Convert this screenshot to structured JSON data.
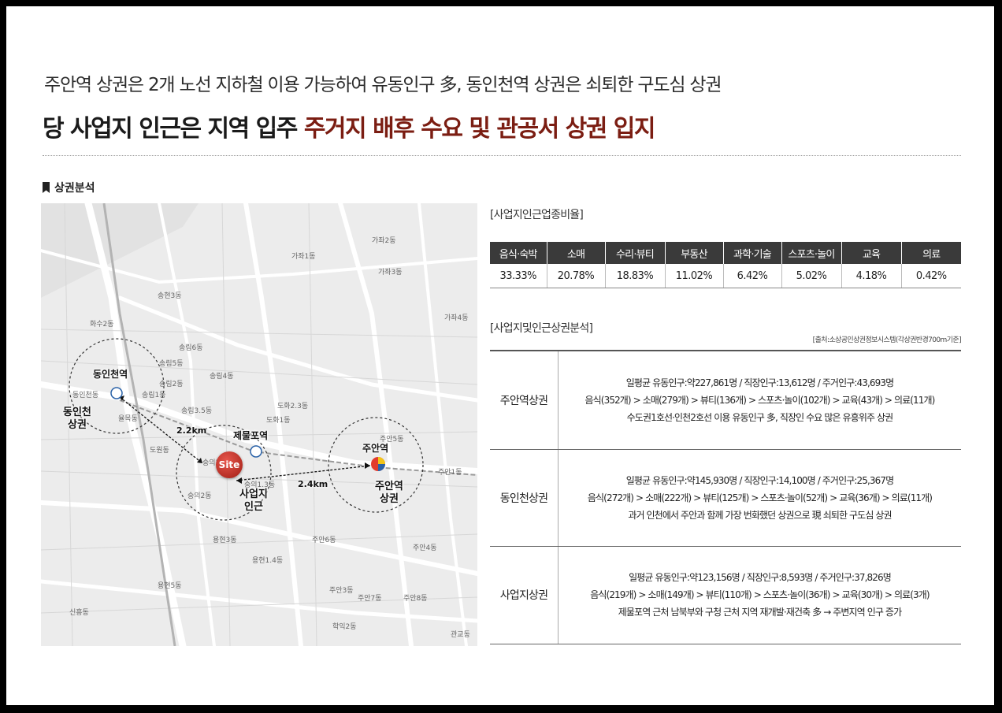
{
  "header": {
    "line1": "주안역 상권은 2개 노선 지하철 이용 가능하여 유동인구 多, 동인천역 상권은 쇠퇴한 구도심 상권",
    "line2_plain": "당 사업지 인근은 지역 입주 ",
    "line2_accent": "주거지 배후 수요 및 관공서 상권 입지",
    "accent_color": "#7b1d12"
  },
  "section_label": "상권분석",
  "map": {
    "districts": [
      "송현3동",
      "화수2동",
      "송림6동",
      "송림5동",
      "송림1동",
      "송림2동",
      "송림4동",
      "송림3.5동",
      "도화1동",
      "도화2.3동",
      "가좌1동",
      "가좌3동",
      "가좌4동",
      "숭의3동",
      "숭의1.3동",
      "숭의2동",
      "주안5동",
      "주안1동",
      "주안4동",
      "주안3동",
      "주안7동",
      "주안8동",
      "주안6동",
      "용현3동",
      "용현1.4동",
      "용현5동",
      "관교동",
      "학익2동",
      "신흥동",
      "율목동",
      "도원동",
      "동인천동",
      "가좌2동"
    ],
    "stations": {
      "dongincheon": "동인천역",
      "jemulpo": "제물포역",
      "juan": "주안역"
    },
    "areas": {
      "dongincheon": "동인천\n상권",
      "site": "사업지\n인근",
      "juan": "주안역\n상권"
    },
    "site_marker": "Site",
    "distance_left": "2.2km",
    "distance_right": "2.4km"
  },
  "ratio": {
    "title": "[사업지인근업종비율]",
    "headers": [
      "음식·숙박",
      "소매",
      "수리·뷰티",
      "부동산",
      "과학·기술",
      "스포츠·놀이",
      "교육",
      "의료"
    ],
    "values": [
      "33.33%",
      "20.78%",
      "18.83%",
      "11.02%",
      "6.42%",
      "5.02%",
      "4.18%",
      "0.42%"
    ]
  },
  "analysis": {
    "title": "[사업지및인근상권분석]",
    "source": "[출처:소상공인상권정보시스템(각상권반경700m기준]",
    "rows": [
      {
        "name": "주안역상권",
        "lines": [
          "일평균 유동인구:약227,861명 / 직장인구:13,612명 / 주거인구:43,693명",
          "음식(352개) > 소매(279개) > 뷰티(136개) > 스포츠·놀이(102개) > 교육(43개) > 의료(11개)",
          "수도권1호선·인천2호선 이용 유동인구 多, 직장인 수요 많은 유흥위주 상권"
        ]
      },
      {
        "name": "동인천상권",
        "lines": [
          "일평균 유동인구:약145,930명 / 직장인구:14,100명 / 주거인구:25,367명",
          "음식(272개) > 소매(222개) > 뷰티(125개) > 스포츠·놀이(52개) > 교육(36개) > 의료(11개)",
          "과거 인천에서 주안과 함께 가장 번화했던 상권으로 現 쇠퇴한 구도심 상권"
        ]
      },
      {
        "name": "사업지상권",
        "lines": [
          "일평균 유동인구:약123,156명 / 직장인구:8,593명 / 주거인구:37,826명",
          "음식(219개) > 소매(149개) > 뷰티(110개) > 스포츠·놀이(36개) > 교육(30개) > 의료(3개)",
          "제물포역 근처 남북부와 구청 근처 지역 재개발·재건축 多 → 주변지역 인구 증가"
        ]
      }
    ]
  }
}
